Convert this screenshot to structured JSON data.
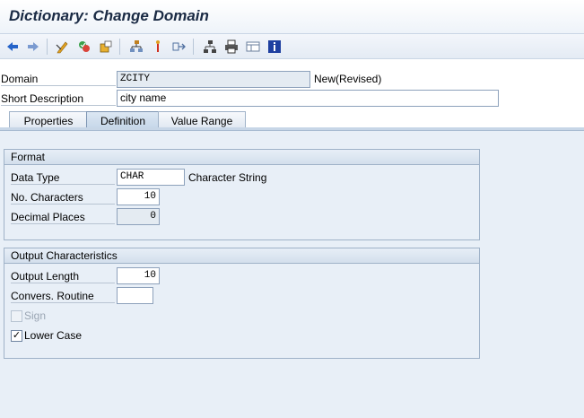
{
  "window": {
    "title": "Dictionary: Change Domain"
  },
  "toolbar": {
    "items": [
      {
        "icon": "back-arrow-icon"
      },
      {
        "icon": "forward-arrow-icon"
      },
      {
        "icon": "display-change-icon"
      },
      {
        "icon": "check-icon"
      },
      {
        "icon": "activate-icon"
      },
      {
        "icon": "where-used-icon"
      },
      {
        "icon": "object-list-icon"
      },
      {
        "icon": "navigate-icon"
      },
      {
        "icon": "hierarchy-icon"
      },
      {
        "icon": "print-icon"
      },
      {
        "icon": "layout-icon"
      },
      {
        "icon": "info-icon"
      }
    ]
  },
  "header": {
    "domain_label": "Domain",
    "domain_value": "ZCITY",
    "domain_status": "New(Revised)",
    "short_desc_label": "Short Description",
    "short_desc_value": "city name"
  },
  "tabs": [
    {
      "label": "Properties",
      "active": false
    },
    {
      "label": "Definition",
      "active": true
    },
    {
      "label": "Value Range",
      "active": false
    }
  ],
  "format": {
    "title": "Format",
    "data_type_label": "Data Type",
    "data_type_value": "CHAR",
    "data_type_desc": "Character String",
    "no_characters_label": "No. Characters",
    "no_characters_value": "10",
    "decimal_places_label": "Decimal Places",
    "decimal_places_value": "0"
  },
  "output": {
    "title": "Output Characteristics",
    "output_length_label": "Output Length",
    "output_length_value": "10",
    "convers_routine_label": "Convers. Routine",
    "convers_routine_value": "",
    "sign_label": "Sign",
    "sign_checked": false,
    "lower_case_label": "Lower Case",
    "lower_case_checked": true,
    "check_mark": "✓"
  }
}
